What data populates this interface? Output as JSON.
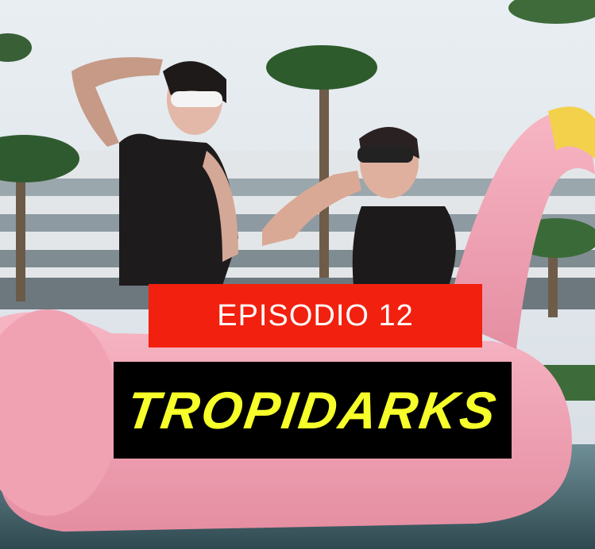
{
  "episode": {
    "label": "EPISODIO 12"
  },
  "title": {
    "text": "TROPIDARKS"
  },
  "colors": {
    "episode_banner": "#f2200e",
    "title_banner": "#000000",
    "title_text": "#f6ff2a",
    "flamingo": "#f0a8b6"
  }
}
